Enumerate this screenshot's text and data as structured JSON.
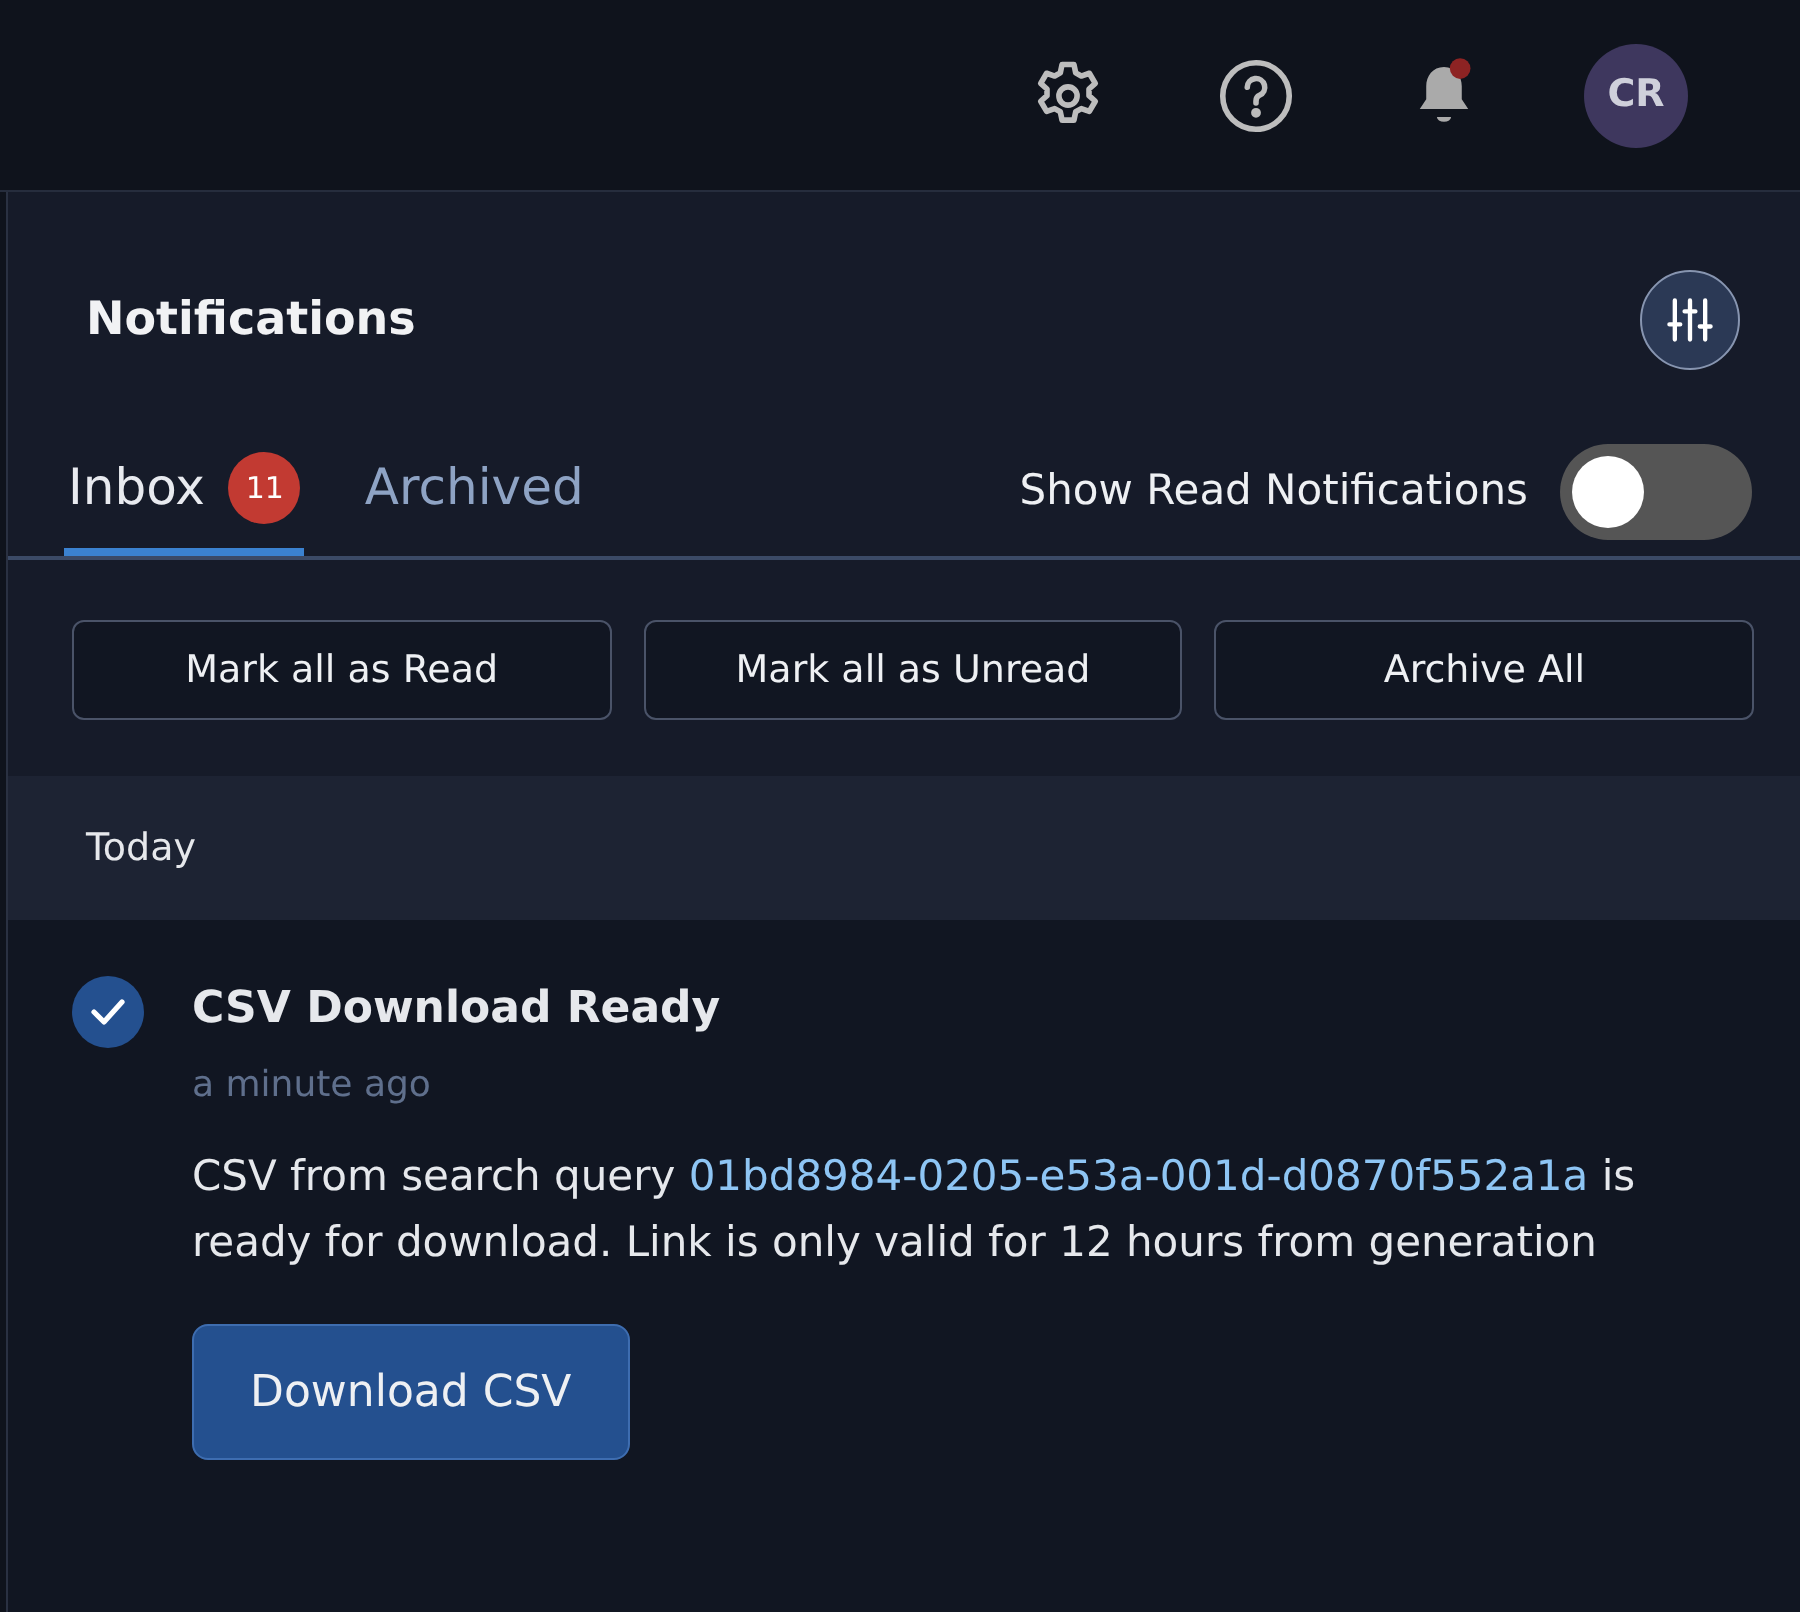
{
  "header": {
    "avatar": "CR",
    "bell_unread": true
  },
  "panel": {
    "title": "Notifications",
    "tabs": [
      {
        "label": "Inbox",
        "badge": "11",
        "selected": true
      },
      {
        "label": "Archived",
        "selected": false
      }
    ],
    "toggle": {
      "label": "Show Read Notifications",
      "on": false
    },
    "actions": [
      "Mark all as Read",
      "Mark all as Unread",
      "Archive All"
    ],
    "groups": [
      {
        "label": "Today",
        "items": [
          {
            "title": "CSV Download Ready",
            "time": "a minute ago",
            "checked": true,
            "body_before": "CSV from search query ",
            "link": "01bd8984-0205-e53a-001d-d0870f552a1a",
            "body_after": " is ready for download. Link is only valid for 12 hours from generation",
            "button": "Download CSV"
          }
        ]
      }
    ]
  }
}
